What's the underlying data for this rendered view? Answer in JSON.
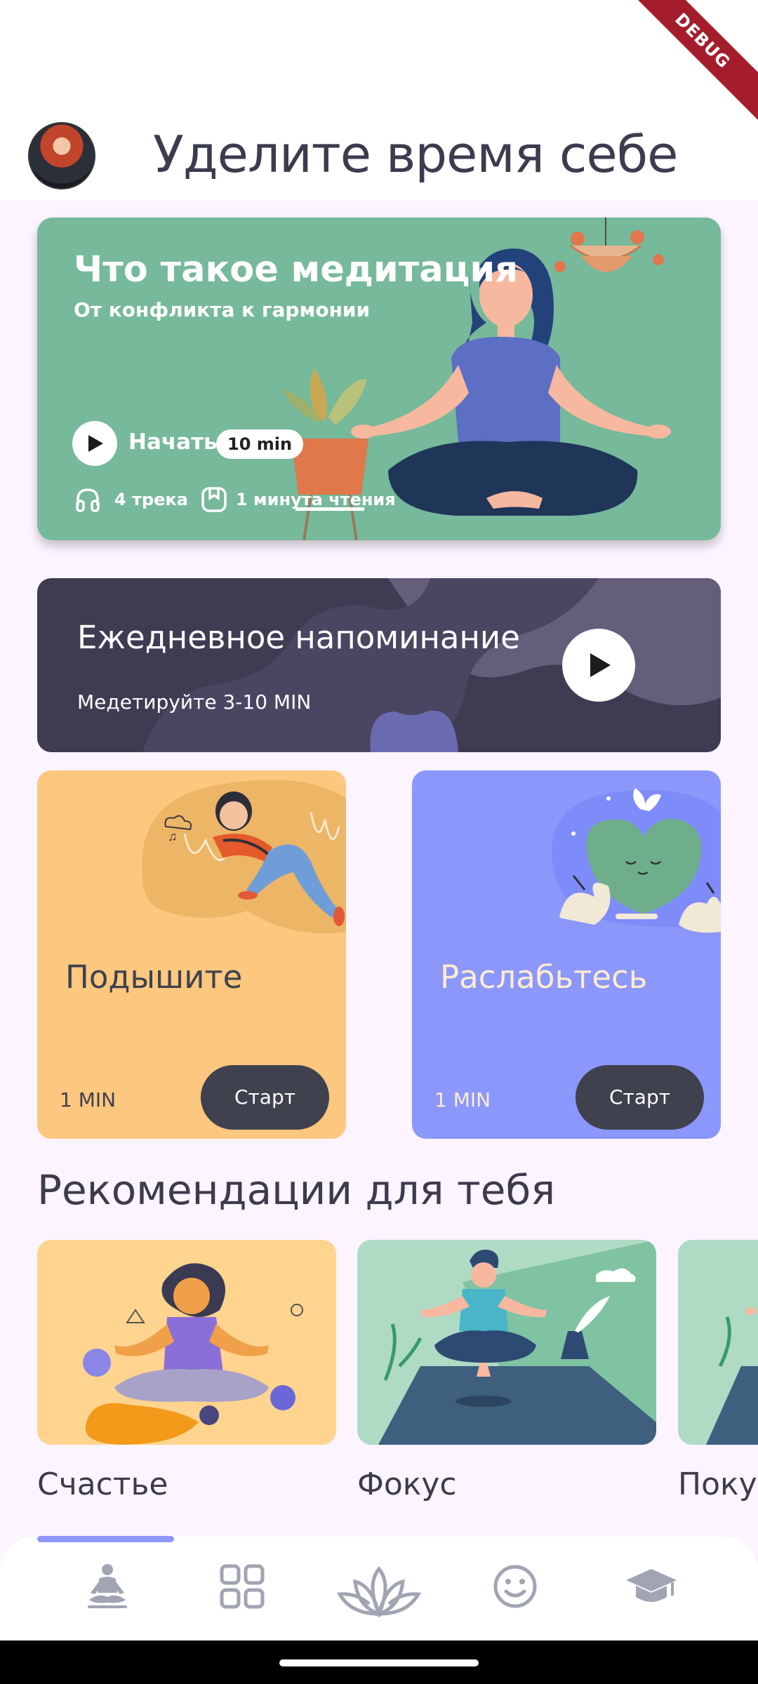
{
  "header": {
    "title": "Уделите время себе",
    "debug_label": "DEBUG"
  },
  "hero": {
    "title": "Что такое медитация",
    "subtitle": "От конфликта к гармонии",
    "start_label": "Начать",
    "duration": "10 min",
    "tracks": "4 трека",
    "reading": "1 минута чтения",
    "color": "#76b99b"
  },
  "reminder": {
    "title": "Ежедневное напоминание",
    "subtitle": "Медетируйте  3-10 MIN",
    "color": "#3f3b52"
  },
  "cards": [
    {
      "title": "Подышите",
      "duration": "1 MIN",
      "button": "Старт",
      "color": "#fcc77e"
    },
    {
      "title": "Раслабьтесь",
      "duration": "1 MIN",
      "button": "Старт",
      "color": "#8b97fb"
    }
  ],
  "recommendations": {
    "heading": "Рекомендации для тебя",
    "items": [
      {
        "label": "Счастье"
      },
      {
        "label": "Фокус"
      },
      {
        "label": "Покуй"
      }
    ]
  },
  "nav": {
    "active_index": 0,
    "items": [
      {
        "icon": "meditation-person-icon"
      },
      {
        "icon": "grid-icon"
      },
      {
        "icon": "lotus-icon"
      },
      {
        "icon": "smiley-icon"
      },
      {
        "icon": "graduation-cap-icon"
      }
    ],
    "accent": "#8e97fd"
  }
}
